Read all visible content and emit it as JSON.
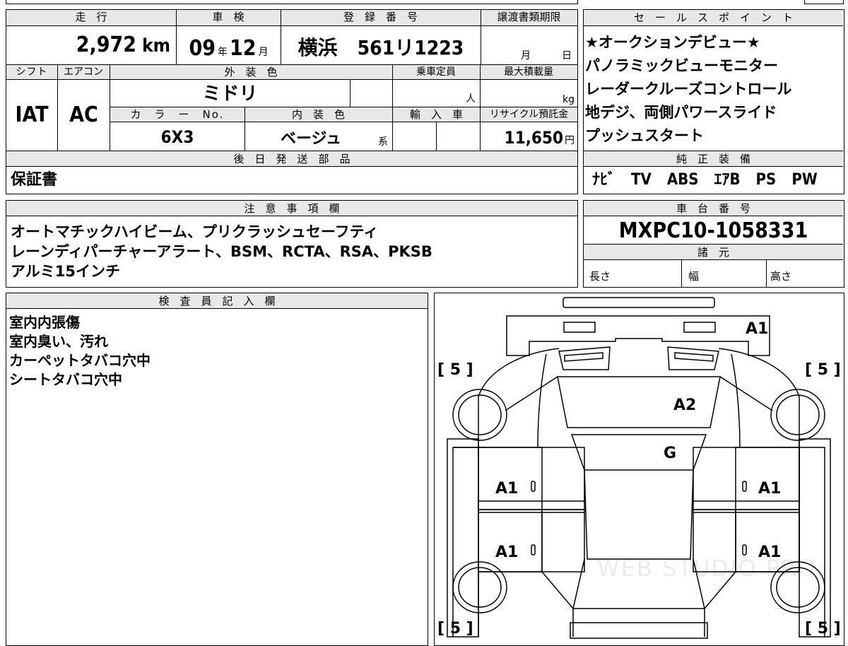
{
  "basic": {
    "mileage_label": "走　行",
    "mileage": "2,972",
    "mileage_unit": "km",
    "inspection_label": "車　検",
    "insp_year": "09",
    "insp_year_unit": "年",
    "insp_month": "12",
    "insp_month_unit": "月",
    "reg_label": "登　録　番　号",
    "reg_number": "横浜　561リ1223",
    "transfer_label": "譲渡書類期限",
    "transfer_month_unit": "月",
    "transfer_day_unit": "日"
  },
  "spec": {
    "shift_label": "シフト",
    "shift": "IAT",
    "ac_label": "エアコン",
    "ac": "AC",
    "ext_color_label": "外　装　色",
    "ext_color": "ミドリ",
    "capacity_label": "乗車定員",
    "capacity_unit": "人",
    "maxload_label": "最大積載量",
    "maxload_unit": "kg",
    "color_no_label": "カ　ラ　ー　No.",
    "color_no": "6X3",
    "int_color_label": "内　装　色",
    "int_color": "ベージュ",
    "int_color_suffix": "系",
    "import_label": "輸　入　車",
    "recycle_label": "リサイクル預託金",
    "recycle": "11,650",
    "recycle_unit": "円"
  },
  "later_parts": {
    "label": "後　日　発　送　部　品",
    "value": "保証書"
  },
  "sales_points": {
    "label": "セ　ー　ル　ス　ポ　イ　ン　ト",
    "lines": [
      "★オークションデビュー★",
      "パノラミックビューモニター",
      "レーダークルーズコントロール",
      "地デジ、両側パワースライド",
      "プッシュスタート"
    ]
  },
  "equipment": {
    "label": "純　正　装　備",
    "value": "ﾅﾋﾞ　TV　ABS　ｴｱB　PS　PW"
  },
  "notes": {
    "label": "注　意　事　項　欄",
    "lines": [
      "オートマチックハイビーム、プリクラッシュセーフティ",
      "レーンディパーチャーアラート、BSM、RCTA、RSA、PKSB",
      "アルミ15インチ"
    ]
  },
  "chassis": {
    "label": "車　台　番　号",
    "value": "MXPC10-1058331",
    "specs_label": "諸　元",
    "length_label": "長さ",
    "width_label": "幅",
    "height_label": "高さ"
  },
  "inspector": {
    "label": "検　査　員　記　入　欄",
    "lines": [
      "室内内張傷",
      "室内臭い、汚れ",
      "カーペットタバコ穴中",
      "シートタバコ穴中"
    ]
  },
  "diagram": {
    "tire_fl": "[ 5 ]",
    "tire_fr": "[ 5 ]",
    "tire_rl": "[ 5 ]",
    "tire_rr": "[ 5 ]",
    "front_bumper": "A1",
    "hood": "A2",
    "windshield": "G",
    "front_left_door": "A1",
    "front_right_door": "A1",
    "rear_left_door": "A1",
    "rear_right_door": "A1",
    "watermark": "WEB STUDIO PRO"
  }
}
